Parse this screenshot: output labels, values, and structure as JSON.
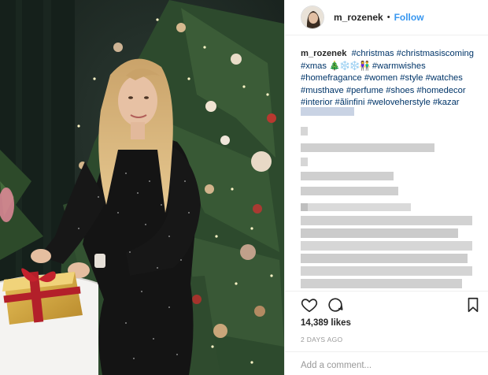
{
  "post": {
    "username": "m_rozenek",
    "dot": "•",
    "follow_label": "Follow",
    "caption": {
      "username": "m_rozenek",
      "line1_tags": [
        "#christmas",
        "#christmasiscoming"
      ],
      "line2_tag": "#xmas",
      "line2_emoji": "🎄❄️❄️👫",
      "line2_tag2": "#warmwishes",
      "line3_tags": [
        "#homefragance",
        "#women",
        "#style",
        "#watches"
      ],
      "line4_tags": [
        "#musthave",
        "#perfume",
        "#shoes",
        "#homedecor"
      ],
      "line5_tags": [
        "#interior",
        "#ălinfini",
        "#weloveherstyle",
        "#kazar"
      ]
    },
    "likes": "14,389 likes",
    "timestamp": "2 DAYS AGO",
    "comment_placeholder": "Add a comment..."
  },
  "icons": {
    "like": "heart-outline-icon",
    "comment": "speech-bubble-icon",
    "save": "bookmark-icon"
  },
  "colors": {
    "link": "#3897f0",
    "hashtag": "#003569",
    "text": "#262626",
    "muted": "#999999"
  }
}
